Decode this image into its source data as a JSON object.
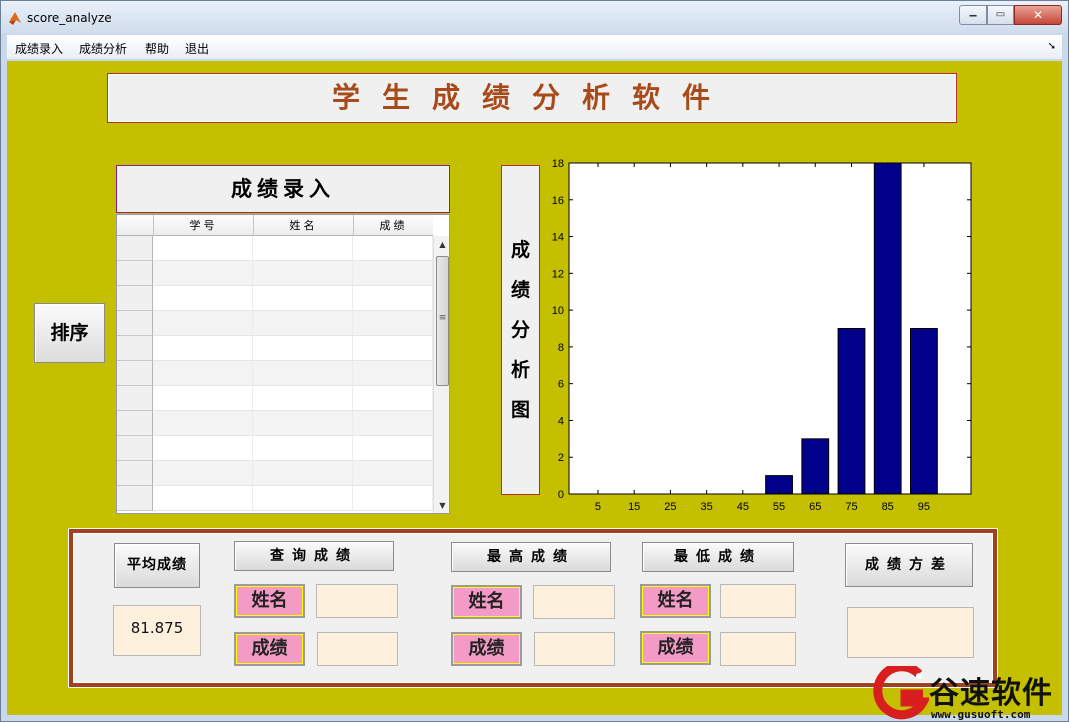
{
  "window": {
    "title": "score_analyze"
  },
  "menu": {
    "items": [
      "成绩录入",
      "成绩分析",
      "帮助",
      "退出"
    ]
  },
  "banner": {
    "title": "学生成绩分析软件"
  },
  "sort_button": "排序",
  "entry": {
    "title": "成绩录入",
    "columns": [
      "学号",
      "姓名",
      "成绩"
    ]
  },
  "chart_label": [
    "成",
    "绩",
    "分",
    "析",
    "图"
  ],
  "chart_data": {
    "type": "bar",
    "categories": [
      "5",
      "15",
      "25",
      "35",
      "45",
      "55",
      "65",
      "75",
      "85",
      "95"
    ],
    "values": [
      0,
      0,
      0,
      0,
      0,
      1,
      3,
      9,
      18,
      9
    ],
    "ylim": [
      0,
      18
    ],
    "yticks": [
      0,
      2,
      4,
      6,
      8,
      10,
      12,
      14,
      16,
      18
    ],
    "bar_color": "#00008b"
  },
  "panel": {
    "avg_button": "平均成绩",
    "avg_value": "81.875",
    "query_button": "查询成绩",
    "max_button": "最高成绩",
    "min_button": "最低成绩",
    "var_button": "成绩方差",
    "name_label": "姓名",
    "score_label": "成绩"
  },
  "watermark": {
    "text": "谷速软件",
    "url": "www.gusuoft.com"
  },
  "colors": {
    "background": "#c4c000",
    "panel_border": "#a0421f",
    "pink_label": "#f39ac6",
    "field_fill": "#fdf0dd"
  }
}
